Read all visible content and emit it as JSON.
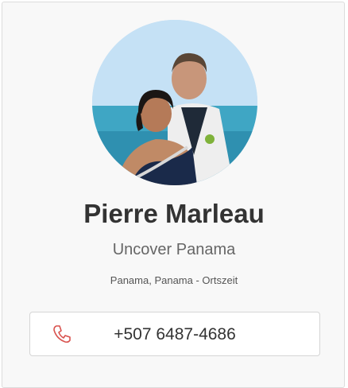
{
  "profile": {
    "name": "Pierre Marleau",
    "company": "Uncover Panama",
    "location": "Panama, Panama - Ortszeit",
    "photo_alt": "Profile photo"
  },
  "contact": {
    "phone": "+507 6487-4686",
    "phone_icon": "phone-icon",
    "phone_icon_color": "#d9534f"
  }
}
